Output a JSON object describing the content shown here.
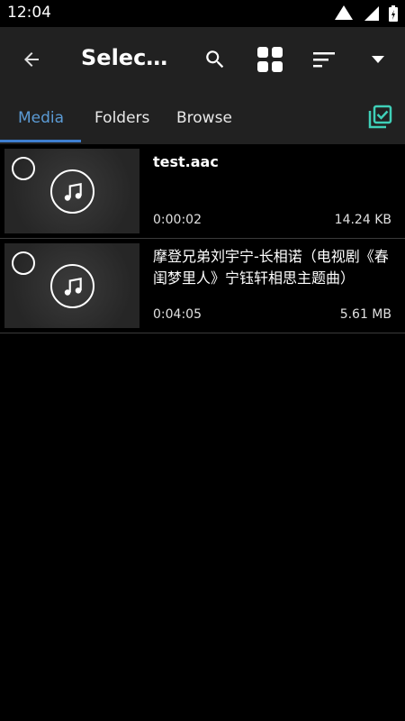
{
  "status_bar": {
    "time": "12:04"
  },
  "toolbar": {
    "title": "Select…",
    "icons": [
      "back-arrow-icon",
      "search-icon",
      "grid-view-icon",
      "sort-icon",
      "dropdown-triangle-icon"
    ]
  },
  "tabs": [
    {
      "label": "Media",
      "active": true
    },
    {
      "label": "Folders",
      "active": false
    },
    {
      "label": "Browse",
      "active": false
    }
  ],
  "accent_color": "#3fd0b8",
  "active_tab_color": "#5b9bd5",
  "items": [
    {
      "title": "test.aac",
      "duration": "0:00:02",
      "size": "14.24 KB",
      "selected": false
    },
    {
      "title": "摩登兄弟刘宇宁-长相诺（电视剧《春闺梦里人》宁钰轩相思主题曲）",
      "duration": "0:04:05",
      "size": "5.61 MB",
      "selected": false
    }
  ]
}
